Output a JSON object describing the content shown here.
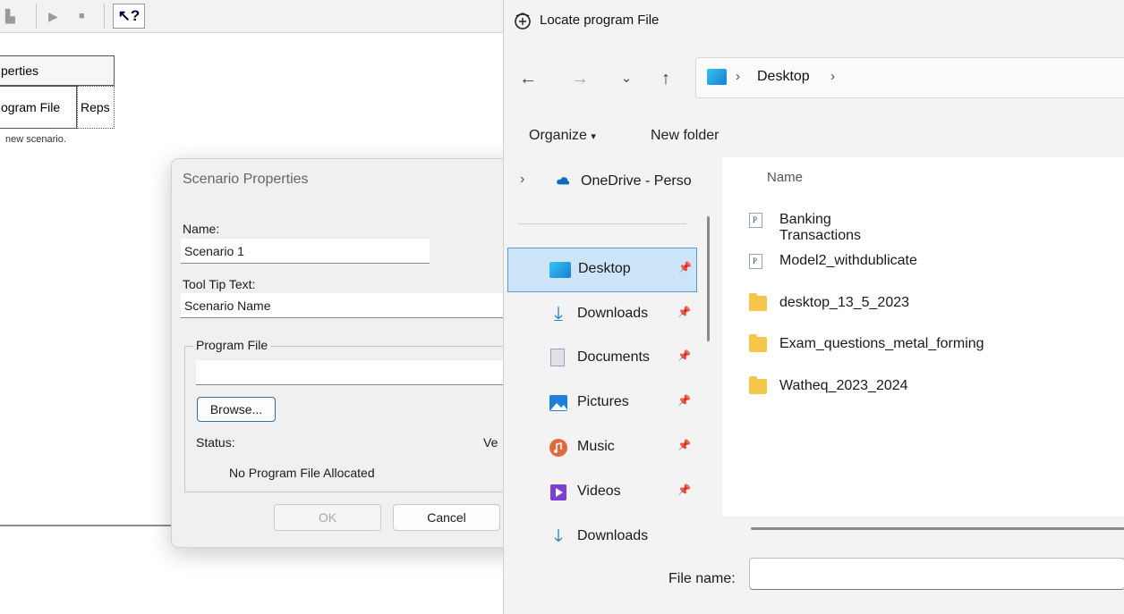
{
  "background_app": {
    "tab_properties": "perties",
    "tab_program_file": "ogram File",
    "tab_reps": "Reps",
    "hint": "new scenario."
  },
  "scenario_dialog": {
    "title": "Scenario Properties",
    "name_label": "Name:",
    "name_value": "Scenario 1",
    "tooltip_label": "Tool Tip Text:",
    "tooltip_value": "Scenario Name",
    "program_group": "Program File",
    "program_value": "",
    "browse_label": "Browse...",
    "status_label": "Status:",
    "version_label": "Ve",
    "status_value": "No Program File Allocated",
    "ok_label": "OK",
    "cancel_label": "Cancel"
  },
  "file_dialog": {
    "title": "Locate program File",
    "breadcrumb": [
      "Desktop"
    ],
    "organize_label": "Organize",
    "new_folder_label": "New folder",
    "nav_items": [
      {
        "label": "OneDrive - Perso",
        "icon": "onedrive-icon"
      },
      {
        "label": "Desktop",
        "icon": "desktop-icon",
        "selected": true
      },
      {
        "label": "Downloads",
        "icon": "download-icon"
      },
      {
        "label": "Documents",
        "icon": "document-icon"
      },
      {
        "label": "Pictures",
        "icon": "pictures-icon"
      },
      {
        "label": "Music",
        "icon": "music-icon"
      },
      {
        "label": "Videos",
        "icon": "videos-icon"
      },
      {
        "label": "Downloads",
        "icon": "download-icon"
      }
    ],
    "column_name": "Name",
    "files": [
      {
        "name": "Banking Transactions",
        "type": "program"
      },
      {
        "name": "Model2_withdublicate",
        "type": "program"
      },
      {
        "name": "desktop_13_5_2023",
        "type": "folder"
      },
      {
        "name": "Exam_questions_metal_forming",
        "type": "folder"
      },
      {
        "name": "Watheq_2023_2024",
        "type": "folder"
      }
    ],
    "file_name_label": "File name:",
    "file_name_value": ""
  },
  "colors": {
    "selection": "#cce4f7",
    "selection_border": "#5b9bd5",
    "folder": "#f6c64a",
    "onedrive": "#0f6cbd"
  }
}
